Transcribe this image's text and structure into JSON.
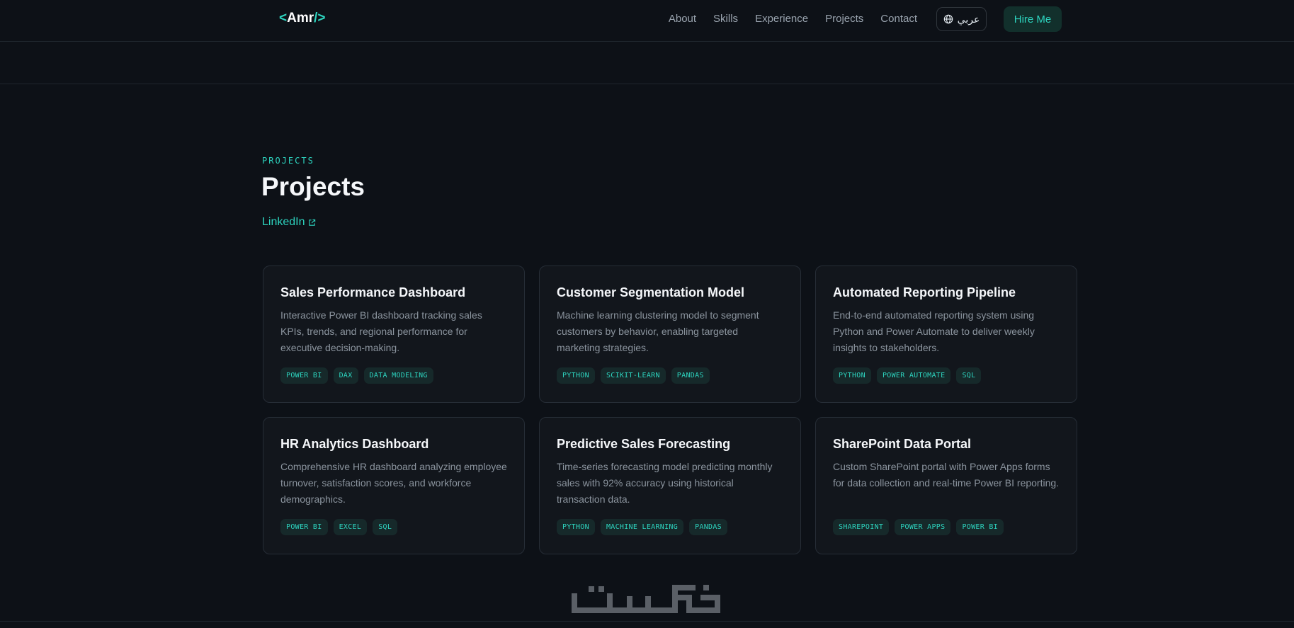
{
  "nav": {
    "logo_prefix": "<",
    "logo_name": "Amr",
    "logo_suffix": "/>",
    "links": [
      "About",
      "Skills",
      "Experience",
      "Projects",
      "Contact"
    ],
    "lang_label": "عربي",
    "hire_label": "Hire Me"
  },
  "section": {
    "eyebrow": "PROJECTS",
    "title": "Projects",
    "link_label": "LinkedIn"
  },
  "projects": [
    {
      "title": "Sales Performance Dashboard",
      "desc": "Interactive Power BI dashboard tracking sales KPIs, trends, and regional performance for executive decision-making.",
      "tags": [
        "POWER BI",
        "DAX",
        "DATA MODELING"
      ]
    },
    {
      "title": "Customer Segmentation Model",
      "desc": "Machine learning clustering model to segment customers by behavior, enabling targeted marketing strategies.",
      "tags": [
        "PYTHON",
        "SCIKIT-LEARN",
        "PANDAS"
      ]
    },
    {
      "title": "Automated Reporting Pipeline",
      "desc": "End-to-end automated reporting system using Python and Power Automate to deliver weekly insights to stakeholders.",
      "tags": [
        "PYTHON",
        "POWER AUTOMATE",
        "SQL"
      ]
    },
    {
      "title": "HR Analytics Dashboard",
      "desc": "Comprehensive HR dashboard analyzing employee turnover, satisfaction scores, and workforce demographics.",
      "tags": [
        "POWER BI",
        "EXCEL",
        "SQL"
      ]
    },
    {
      "title": "Predictive Sales Forecasting",
      "desc": "Time-series forecasting model predicting monthly sales with 92% accuracy using historical transaction data.",
      "tags": [
        "PYTHON",
        "MACHINE LEARNING",
        "PANDAS"
      ]
    },
    {
      "title": "SharePoint Data Portal",
      "desc": "Custom SharePoint portal with Power Apps forms for data collection and real-time Power BI reporting.",
      "tags": [
        "SHAREPOINT",
        "POWER APPS",
        "POWER BI"
      ]
    }
  ],
  "watermark": "خمسات",
  "colors": {
    "accent": "#2dd4bf",
    "background": "#0d1117",
    "card": "#12161c"
  }
}
